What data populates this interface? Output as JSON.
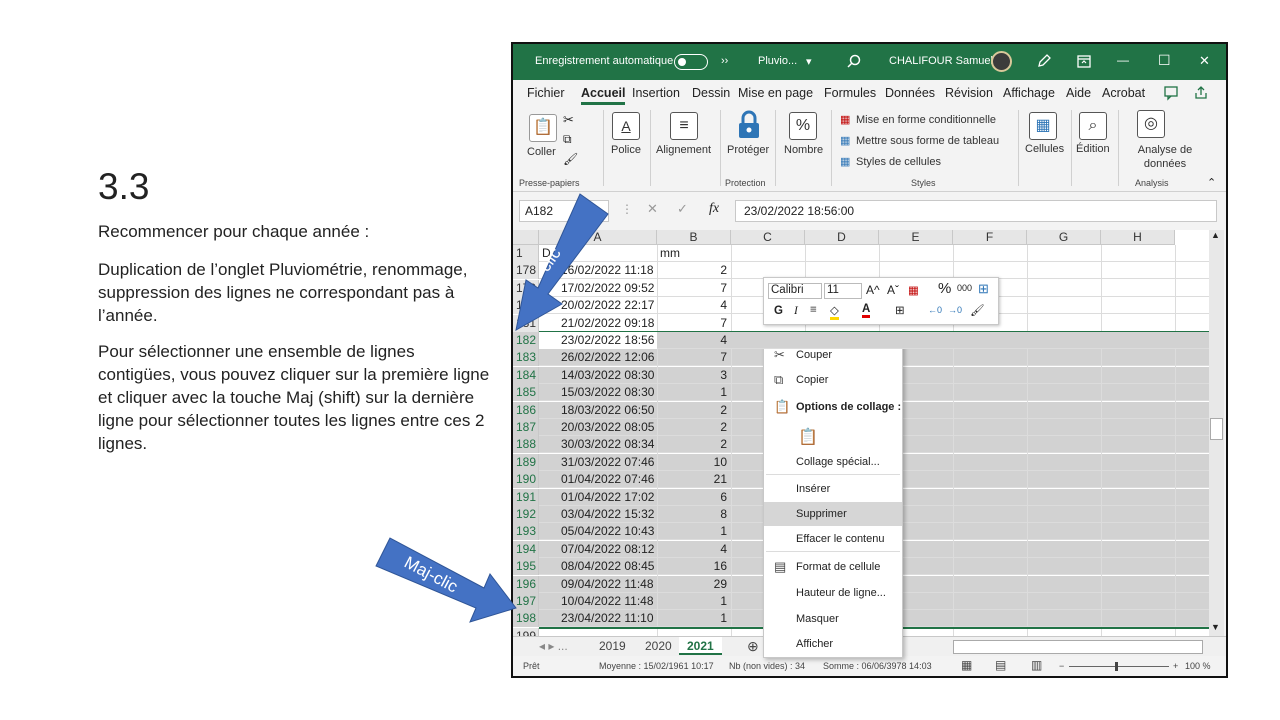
{
  "slide": {
    "title": "3.3",
    "p1": "Recommencer pour chaque année :",
    "p2": "Duplication de l’onglet Pluviométrie, renommage, suppression des lignes ne correspondant pas à l’année.",
    "p3": "Pour sélectionner une ensemble de lignes contigües, vous pouvez cliquer sur la première ligne et cliquer avec la touche Maj (shift) sur la dernière ligne pour sélectionner toutes les lignes entre ces 2 lignes.",
    "arrow1_label": "clic",
    "arrow2_label": "Maj-clic"
  },
  "titlebar": {
    "autosave": "Enregistrement automatique",
    "chevrons": "››",
    "filename": "Pluvio...",
    "dropdown": "▾",
    "user": "CHALIFOUR Samuel",
    "minimize": "—",
    "maximize": "☐",
    "close": "✕"
  },
  "menu": [
    "Fichier",
    "Accueil",
    "Insertion",
    "Dessin",
    "Mise en page",
    "Formules",
    "Données",
    "Révision",
    "Affichage",
    "Aide",
    "Acrobat"
  ],
  "ribbon": {
    "coller": "Coller",
    "presse_papiers": "Presse-papiers",
    "police": "Police",
    "alignement": "Alignement",
    "proteger": "Protéger",
    "protection": "Protection",
    "nombre": "Nombre",
    "mfc": "Mise en forme conditionnelle",
    "mstab": "Mettre sous forme de tableau",
    "styles_cellules": "Styles de cellules",
    "styles": "Styles",
    "cellules": "Cellules",
    "edition": "Édition",
    "analyse": "Analyse de données",
    "analysis_group": "Analysis"
  },
  "formula": {
    "namebox": "A182",
    "fx": "fx",
    "value": "23/02/2022  18:56:00"
  },
  "columns": [
    "A",
    "B",
    "C",
    "D",
    "E",
    "F",
    "G",
    "H"
  ],
  "rows": [
    {
      "n": "1",
      "a": "D",
      "b": "mm"
    },
    {
      "n": "178",
      "a": "16/02/2022 11:18",
      "b": "2"
    },
    {
      "n": "179",
      "a": "17/02/2022 09:52",
      "b": "7"
    },
    {
      "n": "180",
      "a": "20/02/2022 22:17",
      "b": "4"
    },
    {
      "n": "181",
      "a": "21/02/2022 09:18",
      "b": "7"
    },
    {
      "n": "182",
      "a": "23/02/2022 18:56",
      "b": "4"
    },
    {
      "n": "183",
      "a": "26/02/2022 12:06",
      "b": "7"
    },
    {
      "n": "184",
      "a": "14/03/2022 08:30",
      "b": "3"
    },
    {
      "n": "185",
      "a": "15/03/2022 08:30",
      "b": "1"
    },
    {
      "n": "186",
      "a": "18/03/2022 06:50",
      "b": "2"
    },
    {
      "n": "187",
      "a": "20/03/2022 08:05",
      "b": "2"
    },
    {
      "n": "188",
      "a": "30/03/2022 08:34",
      "b": "2"
    },
    {
      "n": "189",
      "a": "31/03/2022 07:46",
      "b": "10"
    },
    {
      "n": "190",
      "a": "01/04/2022 07:46",
      "b": "21"
    },
    {
      "n": "191",
      "a": "01/04/2022 17:02",
      "b": "6"
    },
    {
      "n": "192",
      "a": "03/04/2022 15:32",
      "b": "8"
    },
    {
      "n": "193",
      "a": "05/04/2022 10:43",
      "b": "1"
    },
    {
      "n": "194",
      "a": "07/04/2022 08:12",
      "b": "4"
    },
    {
      "n": "195",
      "a": "08/04/2022 08:45",
      "b": "16"
    },
    {
      "n": "196",
      "a": "09/04/2022 11:48",
      "b": "29"
    },
    {
      "n": "197",
      "a": "10/04/2022 11:48",
      "b": "1"
    },
    {
      "n": "198",
      "a": "23/04/2022 11:10",
      "b": "1"
    },
    {
      "n": "199",
      "a": "",
      "b": ""
    }
  ],
  "sheets": {
    "t1": "2019",
    "t2": "2020",
    "t3": "2021",
    "nav": "◂  ▸  ...",
    "add": "⊕"
  },
  "status": {
    "ready": "Prêt",
    "avg": "Moyenne : 15/02/1961 10:17",
    "count": "Nb (non vides) : 34",
    "sum": "Somme : 06/06/3978 14:03",
    "zoom": "100 %"
  },
  "minibar": {
    "font": "Calibri",
    "size": "11",
    "grow": "A^",
    "shrink": "Aˇ",
    "percent": "%",
    "thousands": "000",
    "bold": "G",
    "italic": "I"
  },
  "context": {
    "cut": "Couper",
    "copy": "Copier",
    "paste_options": "Options de collage :",
    "paste_special": "Collage spécial...",
    "insert": "Insérer",
    "delete": "Supprimer",
    "clear": "Effacer le contenu",
    "format": "Format de cellule",
    "row_height": "Hauteur de ligne...",
    "hide": "Masquer",
    "show": "Afficher"
  },
  "colors": {
    "excel_green": "#217346",
    "arrow_blue": "#4472c4",
    "selection": "#d2d2d2"
  }
}
